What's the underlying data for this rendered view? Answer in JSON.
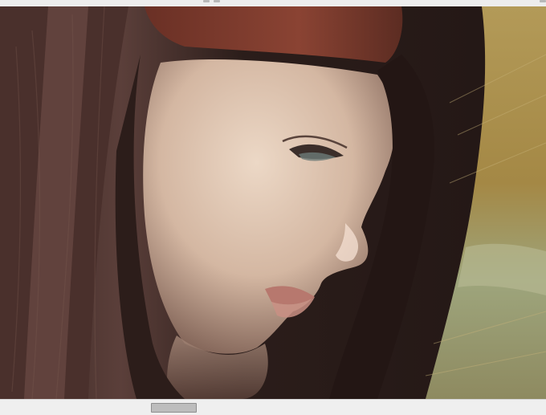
{
  "canvas": {
    "artwork_name": "digital-painting-portrait",
    "colors": {
      "hair_dark": "#2a1c19",
      "hair_mid": "#5a3e39",
      "headband": "#7a3a2c",
      "skin_light": "#ead3c0",
      "skin_mid": "#c9a890",
      "skin_shadow": "#8c6c5e",
      "background_gold": "#a98e4f",
      "background_sage": "#9ea57c",
      "lips": "#b7786e"
    }
  },
  "scrollbar": {
    "horizontal_position": 0.28
  }
}
